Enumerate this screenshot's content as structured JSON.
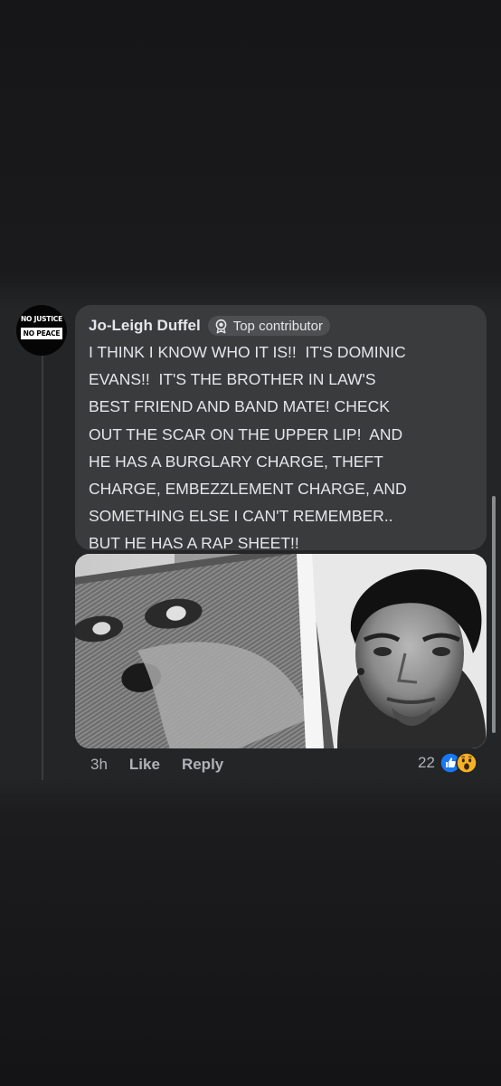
{
  "comment": {
    "avatar": {
      "line1": "NO JUSTICE",
      "line2": "NO PEACE"
    },
    "author": "Jo-Leigh Duffel",
    "badge": {
      "icon": "top-contributor-badge-icon",
      "label": "Top contributor"
    },
    "text": "I THINK I KNOW WHO IT IS!!  IT'S DOMINIC\nEVANS!!  IT'S THE BROTHER IN LAW'S\nBEST FRIEND AND BAND MATE! CHECK\nOUT THE SCAR ON THE UPPER LIP!  AND\nHE HAS A BURGLARY CHARGE, THEFT\nCHARGE, EMBEZZLEMENT CHARGE, AND\nSOMETHING ELSE I CAN'T REMEMBER..\nBUT HE HAS A RAP SHEET!!",
    "time": "3h",
    "actions": {
      "like": "Like",
      "reply": "Reply"
    },
    "reactions": {
      "count": "22",
      "icons": [
        "like-reaction-icon",
        "wow-reaction-icon"
      ]
    }
  },
  "colors": {
    "bubble": "#3a3b3c",
    "text": "#e4e6eb",
    "secondary_text": "#b0b3b8",
    "like_blue": "#1877f2",
    "wow_yellow": "#f7b125"
  }
}
